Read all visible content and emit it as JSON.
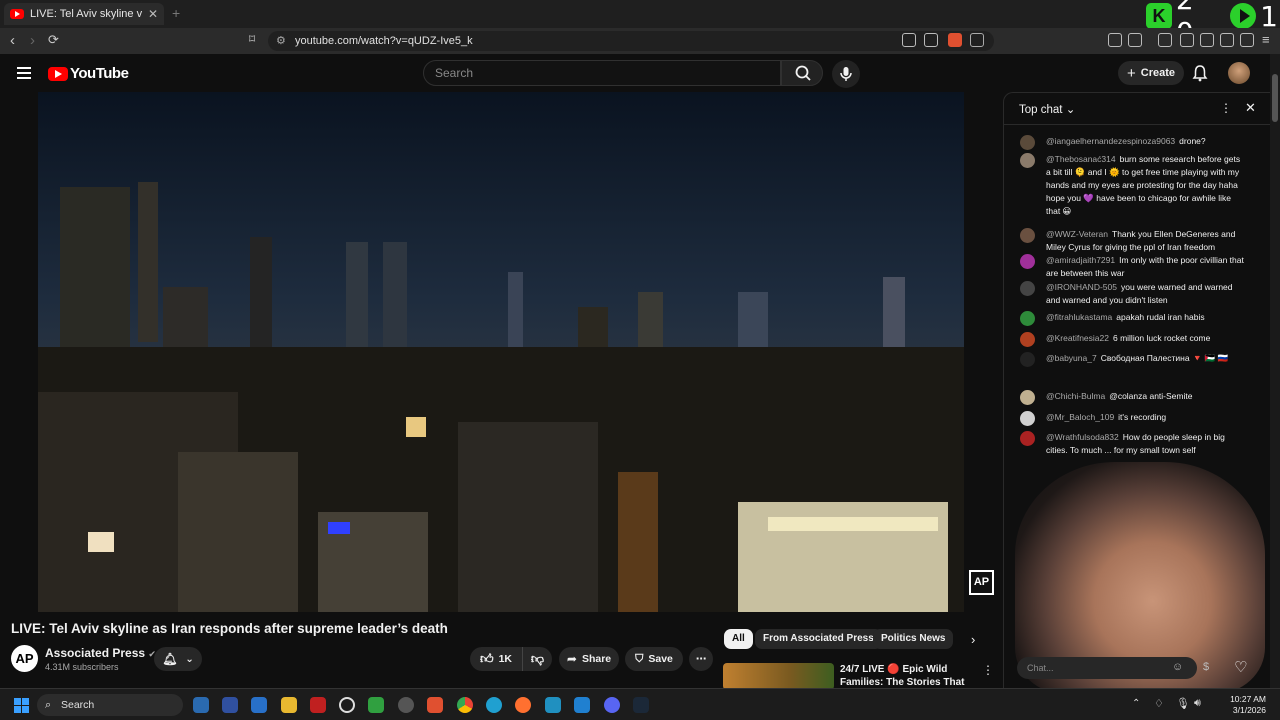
{
  "browser": {
    "tab_title": "LIVE: Tel Aviv skyline view as I",
    "url": "youtube.com/watch?v=qUDZ-Ive5_k",
    "overlay_left": "2 0",
    "overlay_right": "1"
  },
  "yt": {
    "logo_text": "YouTube",
    "search_placeholder": "Search",
    "create_label": "Create"
  },
  "video": {
    "watermark": "AP",
    "title": "LIVE: Tel Aviv skyline as Iran responds after supreme leader’s death",
    "channel_name": "Associated Press",
    "channel_avatar": "AP",
    "subscribers": "4.31M subscribers",
    "likes": "1K",
    "share_label": "Share",
    "save_label": "Save"
  },
  "chips": [
    "All",
    "From Associated Press",
    "Politics News"
  ],
  "recommendation": {
    "title": "24/7 LIVE 🔴 Epic Wild Families: The Stories That ..."
  },
  "chat": {
    "header": "Top chat",
    "input_placeholder": "Chat...",
    "messages": [
      {
        "author": "@iangaelhernandezespinoza9063",
        "text": "drone?",
        "avatar_color": "#5a4a3a"
      },
      {
        "author": "@Thebosanać314",
        "text": "burn some research before gets a bit till 🫠 and I 🌞 to get free time playing with my hands and my eyes are protesting for the day haha hope you 💜 have been to chicago for awhile like that 😀",
        "avatar_color": "#8a7a6a"
      },
      {
        "author": "@WWZ-Veteran",
        "text": "Thank you Ellen DeGeneres and Miley Cyrus for giving the ppl of Iran freedom",
        "avatar_color": "#6a5040"
      },
      {
        "author": "@amiradjaith7291",
        "text": "Im only with the poor civillian that are between this war",
        "avatar_color": "#a0309a"
      },
      {
        "author": "@IRONHAND-505",
        "text": "you were warned and warned and warned and you didn't listen",
        "avatar_color": "#444444"
      },
      {
        "author": "@fitrahlukastama",
        "text": "apakah rudal iran habis",
        "avatar_color": "#2e8b3a"
      },
      {
        "author": "@Kreatifnesia22",
        "text": "6 million luck rocket come",
        "avatar_color": "#b04020"
      },
      {
        "author": "@babyuna_7",
        "text": "Свободная Палестина 🔻 🇵🇸 🇷🇺",
        "avatar_color": "#222222"
      },
      {
        "author": "@Chichi-Bulma",
        "text": "@colanza anti-Semite",
        "avatar_color": "#c0b090"
      },
      {
        "author": "@Mr_Baloch_109",
        "text": "it's recording",
        "avatar_color": "#d0d0d0"
      },
      {
        "author": "@Wrathfulsoda832",
        "text": "How do people sleep in big cities. To much ... for my small town self",
        "avatar_color": "#aa2222"
      }
    ]
  },
  "taskbar": {
    "search_label": "Search",
    "time": "10:27 AM",
    "date": "3/1/2026"
  }
}
